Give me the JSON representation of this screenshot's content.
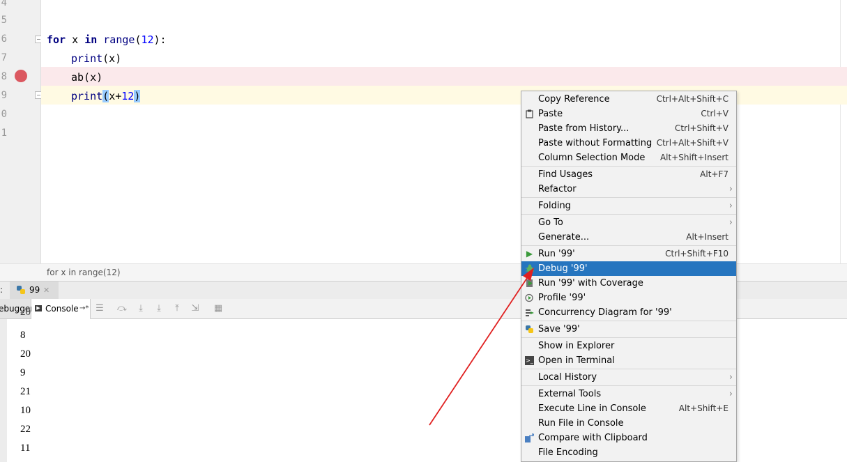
{
  "editor": {
    "line_numbers": [
      "4",
      "5",
      "6",
      "7",
      "8",
      "9",
      "0",
      "1"
    ],
    "code": {
      "line6": {
        "kw1": "for",
        "var": " x ",
        "kw2": "in",
        "rest_fn": " range",
        "paren_open": "(",
        "num": "12",
        "paren_close": "):"
      },
      "line7": {
        "fn": "print",
        "rest": "(x)"
      },
      "line8": {
        "text": "ab(x)"
      },
      "line9": {
        "fn": "print",
        "paren_open": "(",
        "inner": "x+",
        "num": "12",
        "paren_close": ")"
      }
    },
    "breadcrumb": "for x in range(12)"
  },
  "panel": {
    "tab_prefix": ":",
    "run_tab": "99",
    "debugger_tab": "ebugger",
    "console_tab": "Console",
    "console_tab_suffix": "→*",
    "console_output": [
      "8",
      "20",
      "9",
      "21",
      "10",
      "22",
      "11"
    ],
    "console_partial_top": "20"
  },
  "menu": {
    "items": [
      {
        "label": "Copy Reference",
        "shortcut": "Ctrl+Alt+Shift+C"
      },
      {
        "label": "Paste",
        "shortcut": "Ctrl+V",
        "icon": "clipboard-icon"
      },
      {
        "label": "Paste from History...",
        "shortcut": "Ctrl+Shift+V"
      },
      {
        "label": "Paste without Formatting",
        "shortcut": "Ctrl+Alt+Shift+V"
      },
      {
        "label": "Column Selection Mode",
        "shortcut": "Alt+Shift+Insert"
      },
      {
        "label": "Find Usages",
        "shortcut": "Alt+F7"
      },
      {
        "label": "Refactor",
        "submenu": true
      },
      {
        "label": "Folding",
        "submenu": true
      },
      {
        "label": "Go To",
        "submenu": true
      },
      {
        "label": "Generate...",
        "shortcut": "Alt+Insert"
      },
      {
        "label": "Run '99'",
        "shortcut": "Ctrl+Shift+F10",
        "icon": "run-icon"
      },
      {
        "label": "Debug '99'",
        "selected": true,
        "icon": "debug-bug-icon"
      },
      {
        "label": "Run '99' with Coverage",
        "icon": "coverage-icon"
      },
      {
        "label": "Profile '99'",
        "icon": "profile-icon"
      },
      {
        "label": "Concurrency Diagram for '99'",
        "icon": "concurrency-icon"
      },
      {
        "label": "Save '99'",
        "icon": "python-icon"
      },
      {
        "label": "Show in Explorer"
      },
      {
        "label": "Open in Terminal",
        "icon": "terminal-icon"
      },
      {
        "label": "Local History",
        "submenu": true
      },
      {
        "label": "External Tools",
        "submenu": true
      },
      {
        "label": "Execute Line in Console",
        "shortcut": "Alt+Shift+E"
      },
      {
        "label": "Run File in Console"
      },
      {
        "label": "Compare with Clipboard",
        "icon": "compare-icon"
      },
      {
        "label": "File Encoding"
      }
    ]
  },
  "colors": {
    "selection": "#2675bf",
    "breakpoint": "#db5860",
    "annotation_arrow": "#e02020"
  }
}
